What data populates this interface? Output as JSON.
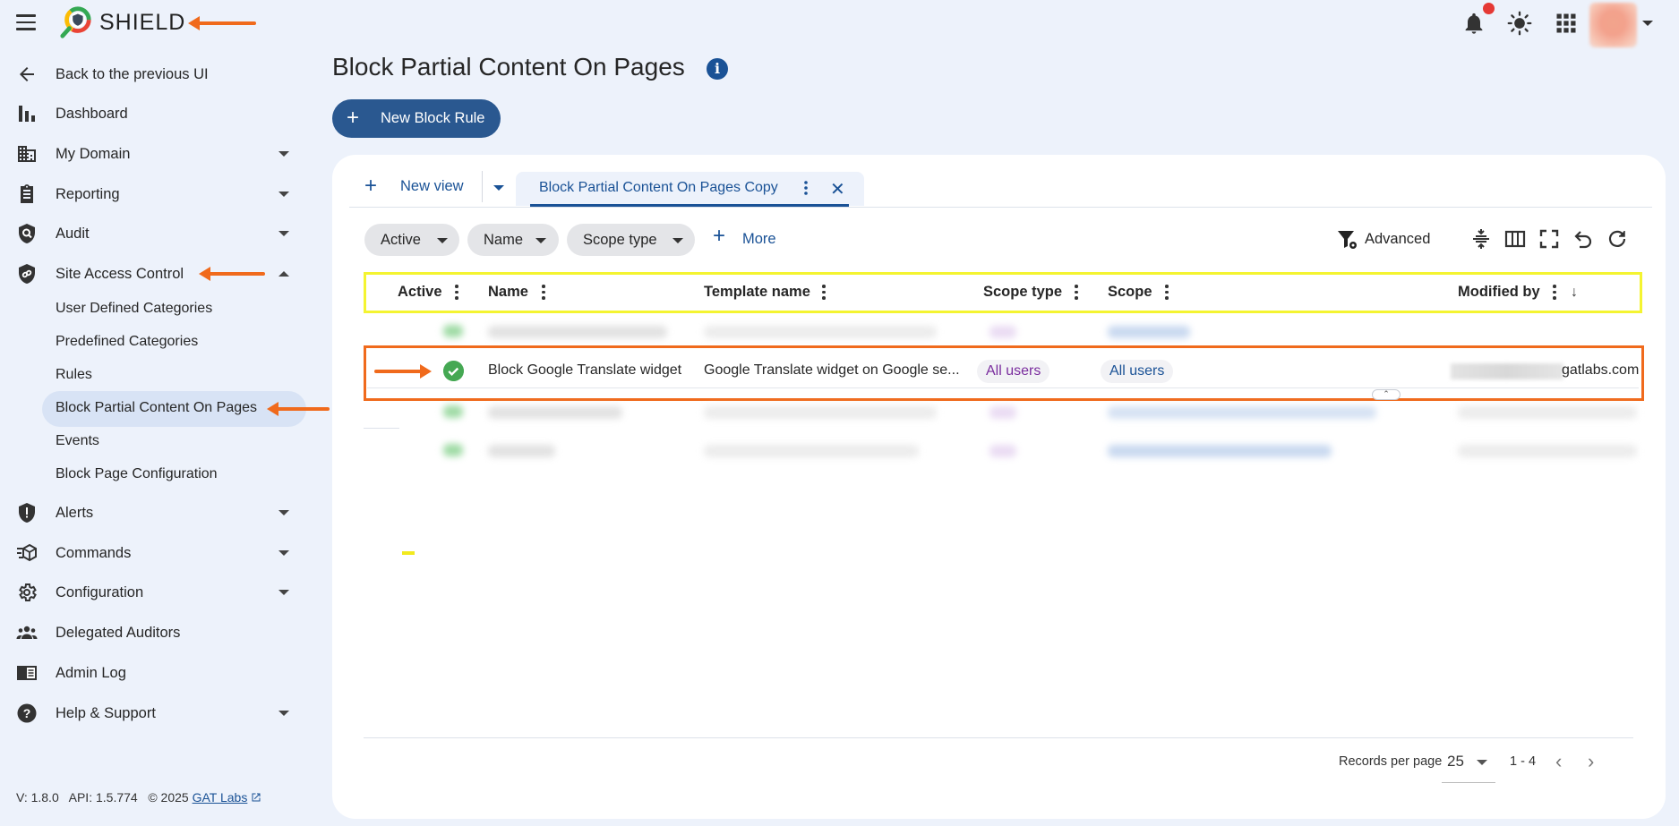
{
  "header": {
    "brand": "SHIELD",
    "icons": [
      "menu-icon",
      "bell-icon",
      "brightness-icon",
      "apps-grid-icon",
      "avatar"
    ]
  },
  "sidebar": {
    "back": "Back to the previous UI",
    "items": [
      {
        "label": "Dashboard",
        "icon": "bar-chart-icon"
      },
      {
        "label": "My Domain",
        "icon": "building-icon"
      },
      {
        "label": "Reporting",
        "icon": "clipboard-icon"
      },
      {
        "label": "Audit",
        "icon": "shield-search-icon"
      },
      {
        "label": "Site Access Control",
        "icon": "shield-link-icon"
      },
      {
        "label": "Alerts",
        "icon": "shield-alert-icon"
      },
      {
        "label": "Commands",
        "icon": "commands-icon"
      },
      {
        "label": "Configuration",
        "icon": "gear-icon"
      },
      {
        "label": "Delegated Auditors",
        "icon": "people-icon"
      },
      {
        "label": "Admin Log",
        "icon": "log-icon"
      },
      {
        "label": "Help & Support",
        "icon": "help-icon"
      }
    ],
    "sub_items": [
      "User Defined Categories",
      "Predefined Categories",
      "Rules",
      "Block Partial Content On Pages",
      "Events",
      "Block Page Configuration"
    ],
    "version": "V: 1.8.0   API: 1.5.774   © 2025",
    "version_link": "GAT Labs"
  },
  "main": {
    "title": "Block Partial Content On Pages",
    "new_button": "New Block Rule",
    "new_view": "New view",
    "active_tab": "Block Partial Content On Pages Copy",
    "filters": [
      "Active",
      "Name",
      "Scope type"
    ],
    "more": "More",
    "advanced": "Advanced",
    "columns": [
      "Active",
      "Name",
      "Template name",
      "Scope type",
      "Scope",
      "Modified by"
    ],
    "row": {
      "name": "Block Google Translate widget",
      "template": "Google Translate widget on Google se...",
      "scope_type": "All users",
      "scope": "All users",
      "modified_by_tail": "gatlabs.com"
    },
    "footer": {
      "records_per_page_label": "Records per page",
      "records_per_page": "25",
      "range": "1 - 4"
    }
  },
  "colors": {
    "accent": "#1a5296",
    "button": "#2a5890",
    "annotation_orange": "#f06a1c",
    "annotation_yellow": "#f4f431",
    "active_green": "#45a853"
  }
}
